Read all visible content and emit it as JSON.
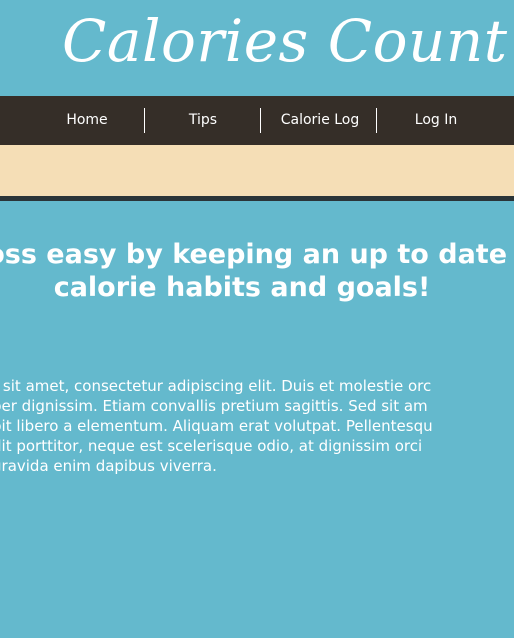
{
  "header": {
    "logo_text": "Calories Count"
  },
  "nav": {
    "items": [
      {
        "label": "Home"
      },
      {
        "label": "Tips"
      },
      {
        "label": "Calorie Log"
      },
      {
        "label": "Log In"
      }
    ]
  },
  "main": {
    "headline_lines": [
      "loss easy by keeping an up to date",
      "calorie habits and goals!"
    ],
    "body_lines": [
      "r sit amet, consectetur adipiscing elit. Duis et molestie orc",
      "per dignissim. Etiam convallis pretium sagittis. Sed sit am",
      "bit libero a elementum. Aliquam erat volutpat. Pellentesqu",
      "dit porttitor, neque est scelerisque odio, at dignissim orci",
      "gravida enim dapibus viverra."
    ]
  },
  "colors": {
    "page_background": "#64b9cd",
    "nav_background": "#352e28",
    "banner_background": "#f5deb6",
    "banner_border": "#2a3438",
    "text": "#ffffff"
  }
}
